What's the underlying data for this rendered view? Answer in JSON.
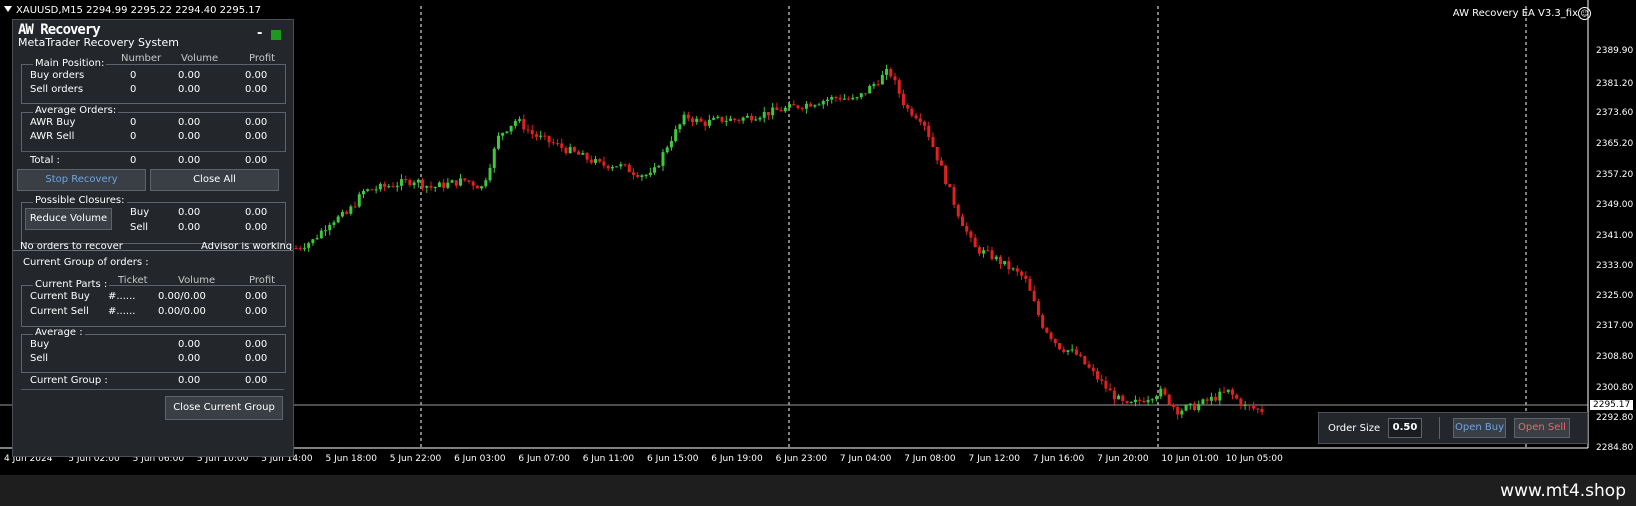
{
  "header": {
    "symbol_line": "XAUUSD,M15  2294.99 2295.22 2294.40 2295.17",
    "ea_label": "AW Recovery EA  V3.3_fix"
  },
  "panel": {
    "title": "AW Recovery",
    "subtitle": "MetaTrader Recovery System",
    "minimize": "-",
    "main": {
      "legend": "Main Position:",
      "headers": [
        "Number",
        "Volume",
        "Profit"
      ],
      "rows": [
        {
          "label": "Buy orders",
          "number": "0",
          "volume": "0.00",
          "profit": "0.00"
        },
        {
          "label": "Sell orders",
          "number": "0",
          "volume": "0.00",
          "profit": "0.00"
        }
      ]
    },
    "avg_orders": {
      "legend": "Average Orders:",
      "rows": [
        {
          "label": "AWR Buy",
          "number": "0",
          "volume": "0.00",
          "profit": "0.00"
        },
        {
          "label": "AWR Sell",
          "number": "0",
          "volume": "0.00",
          "profit": "0.00"
        }
      ]
    },
    "total": {
      "label": "Total :",
      "number": "0",
      "volume": "0.00",
      "profit": "0.00"
    },
    "buttons": {
      "stop": "Stop Recovery",
      "close_all": "Close All",
      "reduce": "Reduce Volume",
      "close_group": "Close Current Group"
    },
    "closures": {
      "legend": "Possible Closures:",
      "rows": [
        {
          "label": "Buy",
          "volume": "0.00",
          "profit": "0.00"
        },
        {
          "label": "Sell",
          "volume": "0.00",
          "profit": "0.00"
        }
      ]
    },
    "status_left": "No orders to recover",
    "status_right": "Advisor is working",
    "group_title": "Current Group of orders :",
    "parts": {
      "legend": "Current Parts :",
      "headers": [
        "Ticket",
        "Volume",
        "Profit"
      ],
      "rows": [
        {
          "label": "Current Buy",
          "ticket": "#......",
          "volume": "0.00/0.00",
          "profit": "0.00"
        },
        {
          "label": "Current Sell",
          "ticket": "#......",
          "volume": "0.00/0.00",
          "profit": "0.00"
        }
      ]
    },
    "average": {
      "legend": "Average :",
      "rows": [
        {
          "label": "Buy",
          "volume": "0.00",
          "profit": "0.00"
        },
        {
          "label": "Sell",
          "volume": "0.00",
          "profit": "0.00"
        }
      ]
    },
    "current_group": {
      "label": "Current Group :",
      "volume": "0.00",
      "profit": "0.00"
    }
  },
  "trade": {
    "order_size_label": "Order Size",
    "order_size_value": "0.50",
    "open_buy": "Open Buy",
    "open_sell": "Open Sell"
  },
  "watermark": "www.mt4.shop",
  "chart_data": {
    "type": "candlestick",
    "price_axis": [
      "2389.90",
      "2381.20",
      "2373.60",
      "2365.20",
      "2357.20",
      "2349.00",
      "2341.00",
      "2333.00",
      "2325.00",
      "2317.00",
      "2308.80",
      "2300.80",
      "2292.80",
      "2284.80"
    ],
    "current_price": "2295.17",
    "time_axis": [
      "4 Jun 2024",
      "5 Jun 02:00",
      "5 Jun 06:00",
      "5 Jun 10:00",
      "5 Jun 14:00",
      "5 Jun 18:00",
      "5 Jun 22:00",
      "6 Jun 03:00",
      "6 Jun 07:00",
      "6 Jun 11:00",
      "6 Jun 15:00",
      "6 Jun 19:00",
      "6 Jun 23:00",
      "7 Jun 04:00",
      "7 Jun 08:00",
      "7 Jun 12:00",
      "7 Jun 16:00",
      "7 Jun 20:00",
      "10 Jun 01:00",
      "10 Jun 05:00"
    ],
    "close_path": [
      [
        2338,
        2340
      ],
      [
        2345,
        2347
      ],
      [
        2353,
        2354
      ],
      [
        2355,
        2356
      ],
      [
        2354,
        2355
      ],
      [
        2356,
        2354
      ],
      [
        2368,
        2372
      ],
      [
        2368,
        2366
      ],
      [
        2364,
        2362
      ],
      [
        2360,
        2360
      ],
      [
        2358,
        2357
      ],
      [
        2366,
        2373
      ],
      [
        2371,
        2372
      ],
      [
        2372,
        2373
      ],
      [
        2374,
        2375
      ],
      [
        2376,
        2377
      ],
      [
        2378,
        2377
      ],
      [
        2381,
        2385
      ],
      [
        2375,
        2372
      ],
      [
        2360,
        2348
      ],
      [
        2338,
        2336
      ],
      [
        2333,
        2330
      ],
      [
        2318,
        2312
      ],
      [
        2310,
        2305
      ],
      [
        2300,
        2296
      ],
      [
        2298,
        2300
      ],
      [
        2295,
        2296
      ],
      [
        2298,
        2300
      ],
      [
        2296,
        2295
      ]
    ],
    "colors": {
      "up": "#3ec83e",
      "down": "#e22020",
      "background": "#000000",
      "grid": "#ffffff"
    }
  }
}
